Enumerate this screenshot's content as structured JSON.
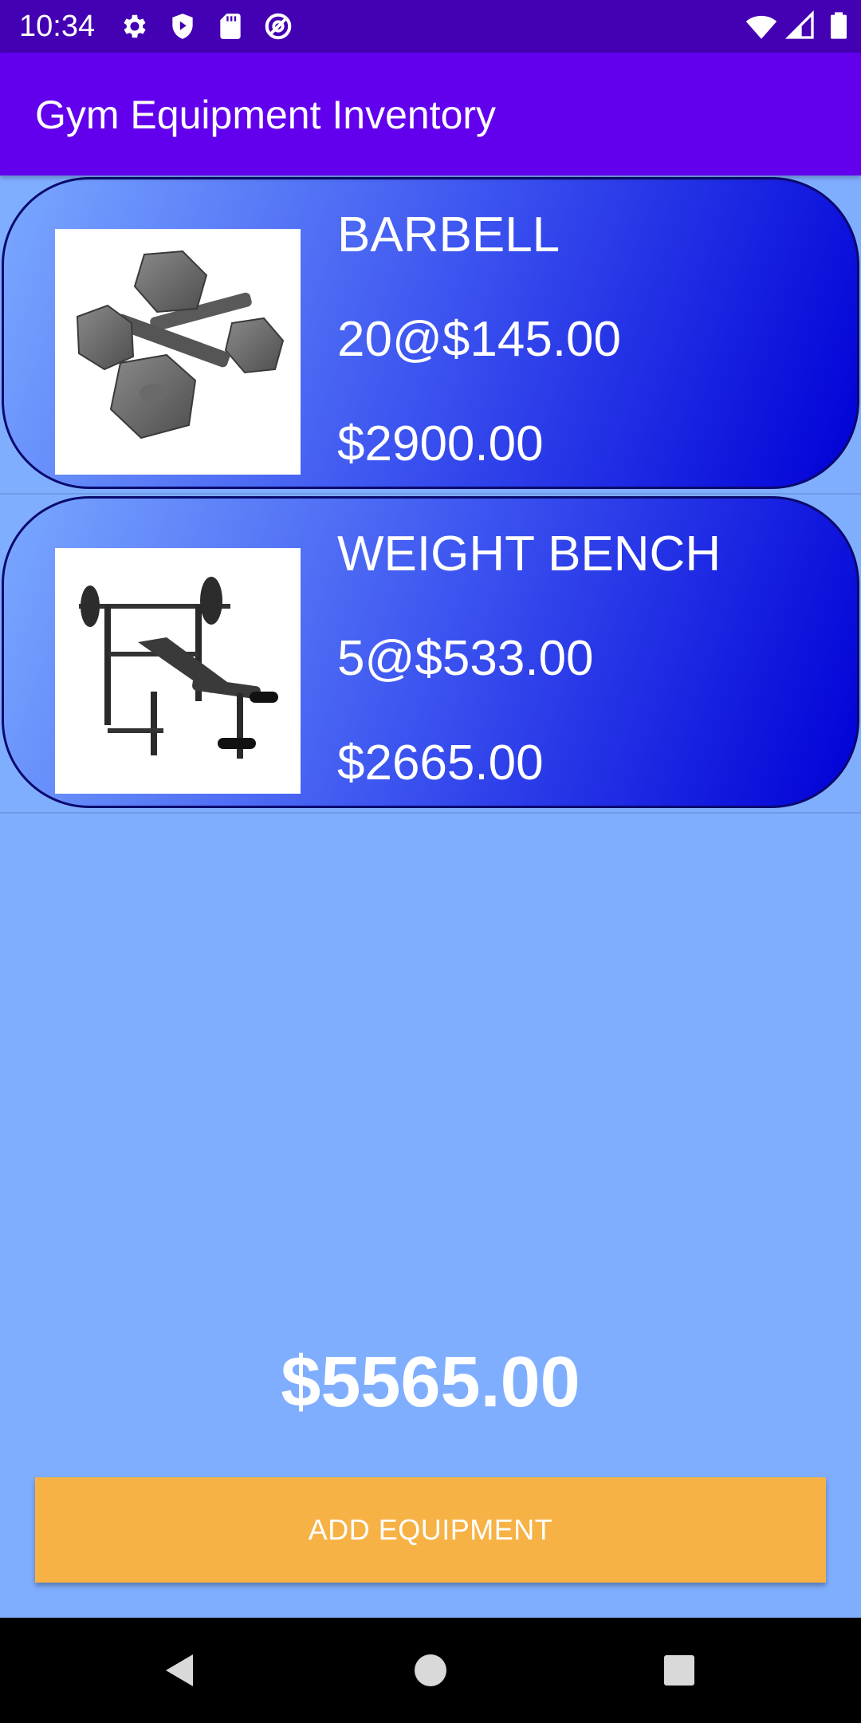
{
  "status_bar": {
    "time": "10:34",
    "left_icons": [
      "gear-icon",
      "shield-play-icon",
      "sd-card-icon",
      "at-sign-icon"
    ],
    "right_icons": [
      "wifi-icon",
      "cellular-signal-icon",
      "battery-icon"
    ]
  },
  "app_bar": {
    "title": "Gym Equipment Inventory"
  },
  "items": [
    {
      "name": "BARBELL",
      "quantity_price": "20@$145.00",
      "total": "$2900.00",
      "image": "dumbbells-image"
    },
    {
      "name": "WEIGHT BENCH",
      "quantity_price": "5@$533.00",
      "total": "$2665.00",
      "image": "weight-bench-image"
    }
  ],
  "grand_total": "$5565.00",
  "add_button_label": "ADD EQUIPMENT",
  "nav": {
    "buttons": [
      "back-icon",
      "home-icon",
      "recents-icon"
    ]
  },
  "colors": {
    "status_bar": "#4400B3",
    "app_bar": "#6200EE",
    "background": "#80AEFF",
    "card_gradient_start": "#7AA8FF",
    "card_gradient_end": "#0000D6",
    "button": "#F7B245"
  }
}
